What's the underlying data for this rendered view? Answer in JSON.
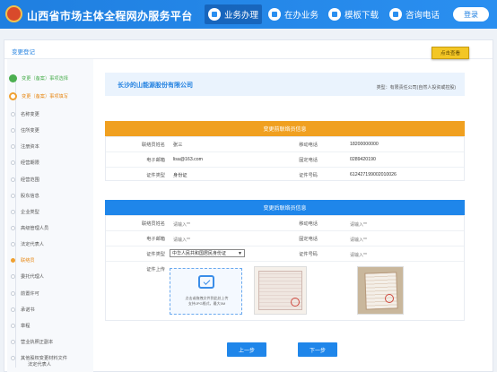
{
  "header": {
    "title": "山西省市场主体全程网办服务平台",
    "nav": [
      {
        "label": "业务办理",
        "icon": "clipboard-icon"
      },
      {
        "label": "在办业务",
        "icon": "document-icon"
      },
      {
        "label": "模板下载",
        "icon": "download-icon"
      },
      {
        "label": "咨询电话",
        "icon": "phone-icon"
      }
    ],
    "login": "登录",
    "colors": {
      "header_bg": "#2a8ff0",
      "accent_orange": "#f0a020",
      "accent_blue": "#1f86ea"
    }
  },
  "panel": {
    "title": "变更登记",
    "doc_button": "点击查看"
  },
  "steps": [
    {
      "label": "变更（备案）事项选择",
      "state": "done"
    },
    {
      "label": "变更（备案）事项填写",
      "state": "current"
    },
    {
      "label": "名称变更",
      "state": "pending"
    },
    {
      "label": "住所变更",
      "state": "pending"
    },
    {
      "label": "注册资本",
      "state": "pending"
    },
    {
      "label": "经营期限",
      "state": "pending"
    },
    {
      "label": "经营范围",
      "state": "pending"
    },
    {
      "label": "股东信息",
      "state": "pending"
    },
    {
      "label": "企业类型",
      "state": "pending"
    },
    {
      "label": "高级管理人员",
      "state": "pending"
    },
    {
      "label": "法定代表人",
      "state": "pending"
    },
    {
      "label": "联络员",
      "state": "highlight"
    },
    {
      "label": "委托代理人",
      "state": "pending"
    },
    {
      "label": "前置许可",
      "state": "pending"
    },
    {
      "label": "承诺书",
      "state": "pending"
    },
    {
      "label": "章程",
      "state": "pending"
    },
    {
      "label": "营业执照正副本",
      "state": "pending"
    },
    {
      "label": "其他股权变更材料文件",
      "sub": "法定代表人",
      "state": "pending"
    }
  ],
  "company": {
    "name": "长沙的山能源股份有限公司",
    "type": "类型：有限责任公司(自然人投资或控股)"
  },
  "before": {
    "header": "变更前联络员信息",
    "rows": [
      {
        "label1": "联络员姓名",
        "value1": "张三",
        "label2": "移动电话",
        "value2": "18200000000"
      },
      {
        "label1": "电子邮箱",
        "value1": "lisa@163.com",
        "label2": "固定电话",
        "value2": "0289420190"
      },
      {
        "label1": "证件类型",
        "value1": "身份证",
        "label2": "证件号码",
        "value2": "612427199002010026"
      }
    ]
  },
  "after": {
    "header": "变更后联络员信息",
    "rows": [
      {
        "label1": "联络员姓名",
        "placeholder1": "请输入**",
        "label2": "移动电话",
        "placeholder2": "请输入**"
      },
      {
        "label1": "电子邮箱",
        "placeholder1": "请输入**",
        "label2": "固定电话",
        "placeholder2": "请输入**"
      },
      {
        "label1": "证件类型",
        "select1": "中华人民共和国居民身份证",
        "label2": "证件号码",
        "placeholder2": "请输入**"
      }
    ],
    "upload_label": "证件上传",
    "upload_hint": "点击或拖拽文件到此处上传",
    "upload_sub": "支持JPG格式，最大5M"
  },
  "buttons": {
    "prev": "上一步",
    "next": "下一步"
  }
}
